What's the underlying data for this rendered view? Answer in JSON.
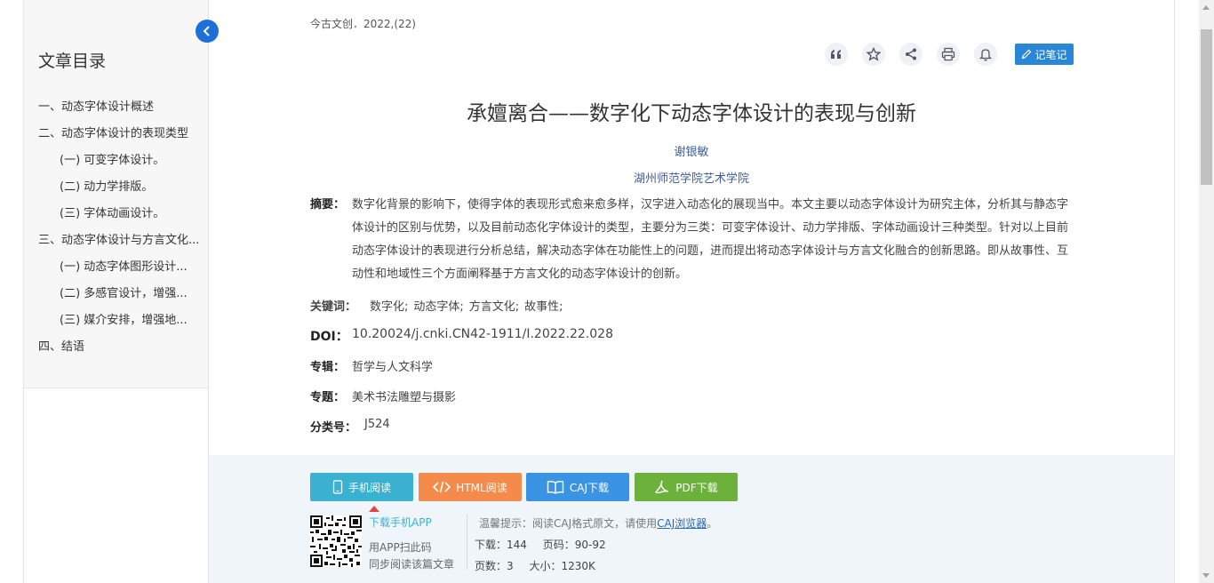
{
  "toc": {
    "title": "文章目录",
    "items": [
      {
        "label": "一、动态字体设计概述",
        "level": 1
      },
      {
        "label": "二、动态字体设计的表现类型",
        "level": 1
      },
      {
        "label": "(一) 可变字体设计。",
        "level": 2
      },
      {
        "label": "(二) 动力学排版。",
        "level": 2
      },
      {
        "label": "(三) 字体动画设计。",
        "level": 2
      },
      {
        "label": "三、动态字体设计与方言文化...",
        "level": 1
      },
      {
        "label": "(一) 动态字体图形设计...",
        "level": 2
      },
      {
        "label": "(二) 多感官设计，增强...",
        "level": 2
      },
      {
        "label": "(三) 媒介安排，增强地...",
        "level": 2
      },
      {
        "label": "四、结语",
        "level": 1
      }
    ]
  },
  "article": {
    "journal": "今古文创．2022,(22)",
    "title": "承嬗离合——数字化下动态字体设计的表现与创新",
    "author": "谢银敏",
    "institution": "湖州师范学院艺术学院",
    "abstract_label": "摘要：",
    "abstract": "数字化背景的影响下，使得字体的表现形式愈来愈多样，汉字进入动态化的展现当中。本文主要以动态字体设计为研究主体，分析其与静态字体设计的区别与优势，以及目前动态化字体设计的类型，主要分为三类：可变字体设计、动力学排版、字体动画设计三种类型。针对以上目前动态字体设计的表现进行分析总结，解决动态字体在功能性上的问题，进而提出将动态字体设计与方言文化融合的创新思路。即从故事性、互动性和地域性三个方面阐释基于方言文化的动态字体设计的创新。",
    "keywords_label": "关键词：",
    "keywords": [
      "数字化;",
      "动态字体;",
      "方言文化;",
      "故事性;"
    ],
    "doi_label": "DOI：",
    "doi": "10.20024/j.cnki.CN42-1911/I.2022.22.028",
    "series_label": "专辑：",
    "series": "哲学与人文科学",
    "topic_label": "专题：",
    "topic": "美术书法雕塑与摄影",
    "class_label": "分类号：",
    "class": "J524"
  },
  "toolbar": {
    "note_label": "记笔记",
    "icons": [
      "quote-icon",
      "star-icon",
      "share-icon",
      "print-icon",
      "bell-icon"
    ]
  },
  "actions": {
    "mobile": "手机阅读",
    "html": "HTML阅读",
    "caj": "CAJ下载",
    "pdf": "PDF下载"
  },
  "download_info": {
    "app_link": "下载手机APP",
    "scan_line1": "用APP扫此码",
    "scan_line2": "同步阅读该篇文章",
    "tip_prefix": "温馨提示：阅读CAJ格式原文，请使用",
    "tip_link": "CAJ浏览器",
    "tip_suffix": "。",
    "downloads": "下载：144",
    "pages_range": "页码：90-92",
    "page_count": "页数：3",
    "size": "大小：1230K"
  },
  "colors": {
    "accent": "#2a87d8",
    "mobile": "#3ab1d1",
    "html": "#f48b4b",
    "caj": "#3a94e3",
    "pdf": "#6bb13c"
  }
}
